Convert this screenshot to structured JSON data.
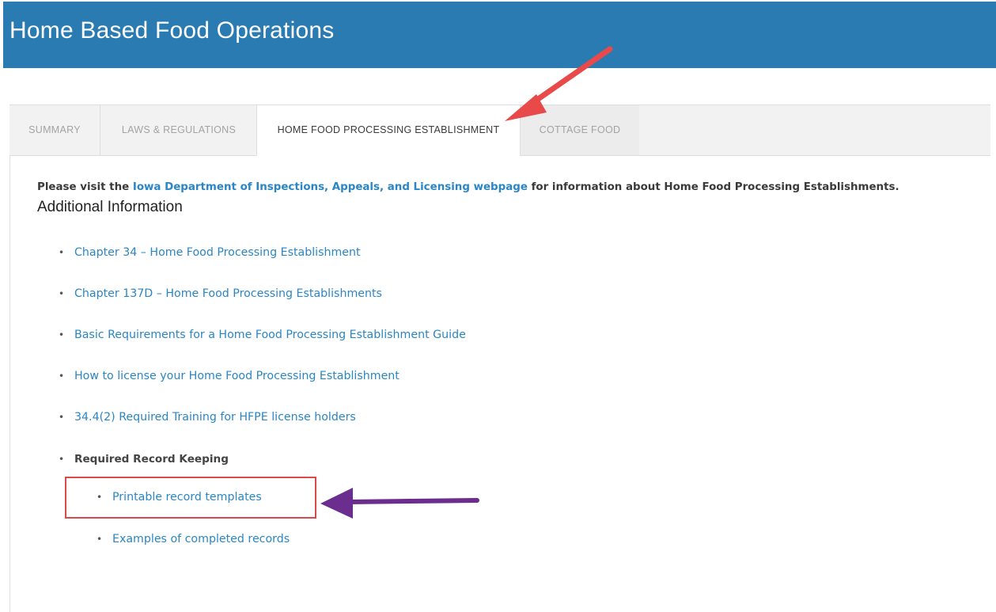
{
  "header": {
    "title": "Home Based Food Operations"
  },
  "tabs": [
    {
      "label": "SUMMARY"
    },
    {
      "label": "LAWS & REGULATIONS"
    },
    {
      "label": "HOME FOOD PROCESSING ESTABLISHMENT"
    },
    {
      "label": "COTTAGE FOOD"
    }
  ],
  "content": {
    "intro_prefix": "Please visit the ",
    "intro_link": "Iowa Department of Inspections, Appeals, and Licensing webpage",
    "intro_suffix": " for information about Home Food Processing Establishments.",
    "heading": "Additional Information",
    "links": [
      "Chapter 34 – Home Food Processing Establishment",
      "Chapter 137D – Home Food Processing Establishments",
      "Basic Requirements  for a Home Food Processing Establishment Guide",
      "How to license your Home Food Processing Establishment",
      "34.4(2) Required Training for HFPE license holders"
    ],
    "record_keeping_label": "Required Record Keeping",
    "sub_links": [
      "Printable record templates",
      "Examples of completed records"
    ]
  },
  "annotations": {
    "tab_arrow_color": "#e84a4a",
    "link_arrow_color": "#6b2e8f",
    "box_color": "#d94a4a"
  }
}
